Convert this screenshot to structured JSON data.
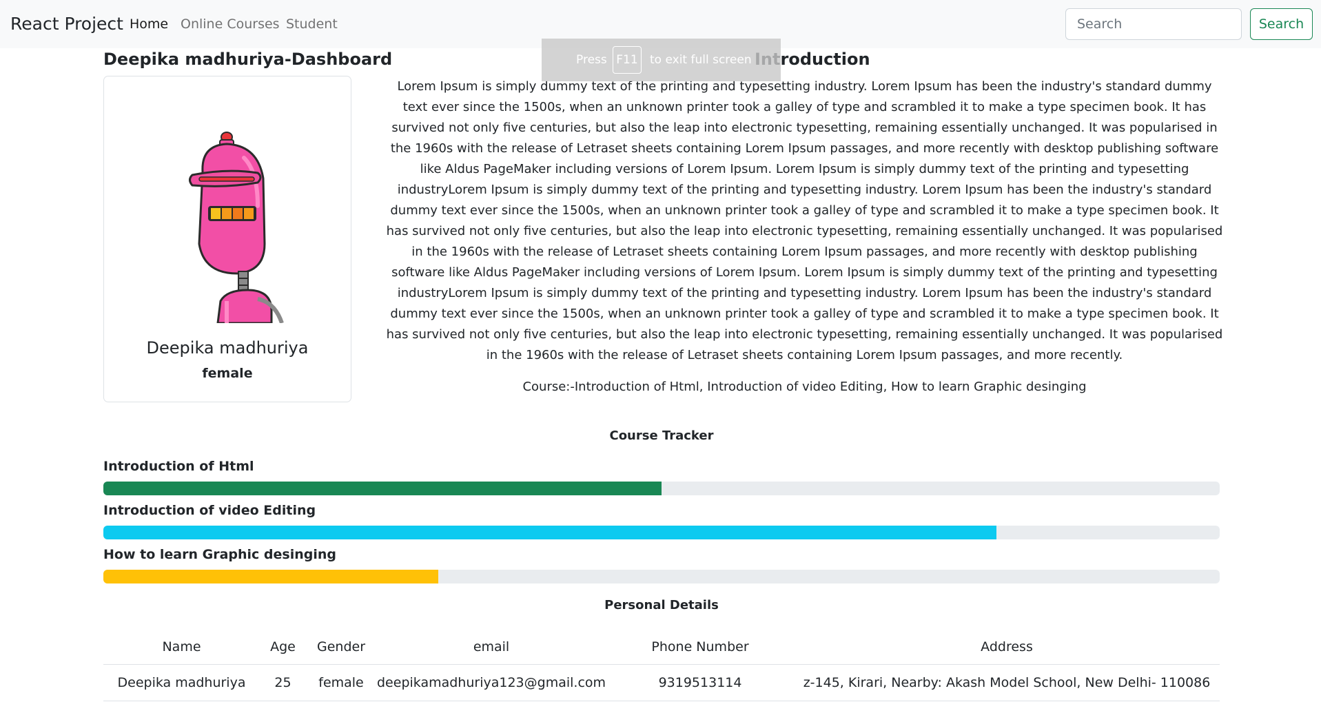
{
  "navbar": {
    "brand": "React Project",
    "links": [
      "Home",
      "Online Courses",
      "Student"
    ],
    "search_placeholder": "Search",
    "search_button": "Search"
  },
  "dashboard": {
    "title": "Deepika madhuriya-Dashboard",
    "profile": {
      "name": "Deepika madhuriya",
      "gender": "female",
      "avatar_icon": "robot-avatar-icon"
    }
  },
  "fullscreen_notice": {
    "press": "Press",
    "key": "F11",
    "message": "to exit full screen"
  },
  "introduction": {
    "title": "Introduction",
    "text": "Lorem Ipsum is simply dummy text of the printing and typesetting industry. Lorem Ipsum has been the industry's standard dummy text ever since the 1500s, when an unknown printer took a galley of type and scrambled it to make a type specimen book. It has survived not only five centuries, but also the leap into electronic typesetting, remaining essentially unchanged. It was popularised in the 1960s with the release of Letraset sheets containing Lorem Ipsum passages, and more recently with desktop publishing software like Aldus PageMaker including versions of Lorem Ipsum. Lorem Ipsum is simply dummy text of the printing and typesetting industryLorem Ipsum is simply dummy text of the printing and typesetting industry. Lorem Ipsum has been the industry's standard dummy text ever since the 1500s, when an unknown printer took a galley of type and scrambled it to make a type specimen book. It has survived not only five centuries, but also the leap into electronic typesetting, remaining essentially unchanged. It was popularised in the 1960s with the release of Letraset sheets containing Lorem Ipsum passages, and more recently with desktop publishing software like Aldus PageMaker including versions of Lorem Ipsum. Lorem Ipsum is simply dummy text of the printing and typesetting industryLorem Ipsum is simply dummy text of the printing and typesetting industry. Lorem Ipsum has been the industry's standard dummy text ever since the 1500s, when an unknown printer took a galley of type and scrambled it to make a type specimen book. It has survived not only five centuries, but also the leap into electronic typesetting, remaining essentially unchanged. It was popularised in the 1960s with the release of Letraset sheets containing Lorem Ipsum passages, and more recently.",
    "courses": "Course:-Introduction of Html, Introduction of video Editing, How to learn Graphic desinging"
  },
  "course_tracker": {
    "title": "Course Tracker",
    "courses": [
      {
        "label": "Introduction of Html",
        "progress": 50,
        "color": "#198754"
      },
      {
        "label": "Introduction of video Editing",
        "progress": 80,
        "color": "#0dcaf0"
      },
      {
        "label": "How to learn Graphic desinging",
        "progress": 30,
        "color": "#ffc107"
      }
    ]
  },
  "personal_details": {
    "title": "Personal Details",
    "columns": [
      "Name",
      "Age",
      "Gender",
      "email",
      "Phone Number",
      "Address"
    ],
    "rows": [
      [
        "Deepika madhuriya",
        "25",
        "female",
        "deepikamadhuriya123@gmail.com",
        "9319513114",
        "z-145, Kirari, Nearby: Akash Model School, New Delhi- 110086"
      ]
    ]
  }
}
